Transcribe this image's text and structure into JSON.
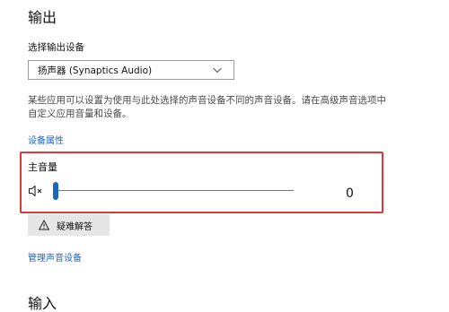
{
  "output": {
    "title": "输出",
    "device_label": "选择输出设备",
    "selected_device": "扬声器 (Synaptics Audio)",
    "description": "某些应用可以设置为使用与此处选择的声音设备不同的声音设备。请在高级声音选项中自定义应用音量和设备。",
    "device_properties_link": "设备属性",
    "master_volume": {
      "label": "主音量",
      "value": 0,
      "value_display": "0",
      "icon": "speaker-muted-icon"
    },
    "troubleshoot_button": "疑难解答",
    "troubleshoot_icon": "warning-icon",
    "manage_devices_link": "管理声音设备"
  },
  "input": {
    "title": "输入"
  },
  "colors": {
    "accent": "#1a66c5",
    "highlight_border": "#d93a3a",
    "button_bg": "#e6e6e6"
  }
}
